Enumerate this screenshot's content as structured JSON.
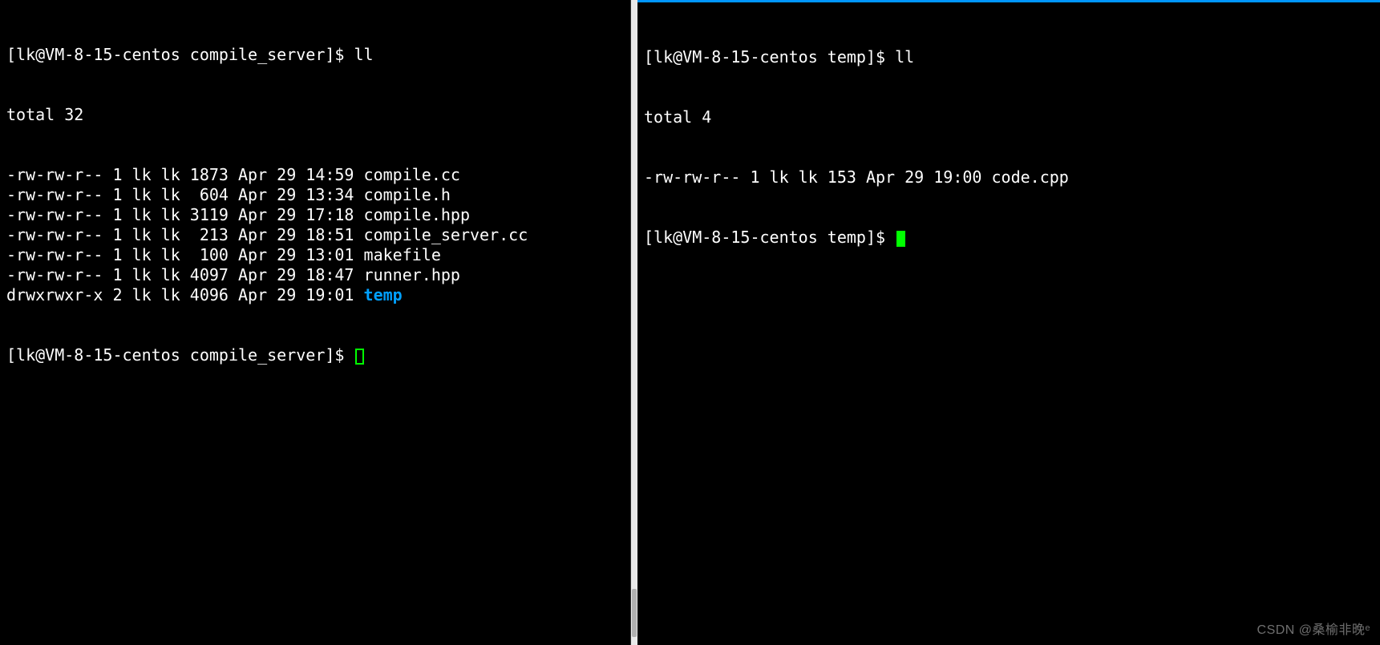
{
  "left": {
    "prompt": "[lk@VM-8-15-centos compile_server]$ ",
    "command": "ll",
    "total": "total 32",
    "entries": [
      {
        "perm": "-rw-rw-r--",
        "links": "1",
        "owner": "lk",
        "group": "lk",
        "size": "1873",
        "date": "Apr 29 14:59",
        "name": "compile.cc",
        "type": "file"
      },
      {
        "perm": "-rw-rw-r--",
        "links": "1",
        "owner": "lk",
        "group": "lk",
        "size": " 604",
        "date": "Apr 29 13:34",
        "name": "compile.h",
        "type": "file"
      },
      {
        "perm": "-rw-rw-r--",
        "links": "1",
        "owner": "lk",
        "group": "lk",
        "size": "3119",
        "date": "Apr 29 17:18",
        "name": "compile.hpp",
        "type": "file"
      },
      {
        "perm": "-rw-rw-r--",
        "links": "1",
        "owner": "lk",
        "group": "lk",
        "size": " 213",
        "date": "Apr 29 18:51",
        "name": "compile_server.cc",
        "type": "file"
      },
      {
        "perm": "-rw-rw-r--",
        "links": "1",
        "owner": "lk",
        "group": "lk",
        "size": " 100",
        "date": "Apr 29 13:01",
        "name": "makefile",
        "type": "file"
      },
      {
        "perm": "-rw-rw-r--",
        "links": "1",
        "owner": "lk",
        "group": "lk",
        "size": "4097",
        "date": "Apr 29 18:47",
        "name": "runner.hpp",
        "type": "file"
      },
      {
        "perm": "drwxrwxr-x",
        "links": "2",
        "owner": "lk",
        "group": "lk",
        "size": "4096",
        "date": "Apr 29 19:01",
        "name": "temp",
        "type": "dir"
      }
    ],
    "prompt2": "[lk@VM-8-15-centos compile_server]$ "
  },
  "right": {
    "prompt": "[lk@VM-8-15-centos temp]$ ",
    "command": "ll",
    "total": "total 4",
    "entries": [
      {
        "perm": "-rw-rw-r--",
        "links": "1",
        "owner": "lk",
        "group": "lk",
        "size": "153",
        "date": "Apr 29 19:00",
        "name": "code.cpp",
        "type": "file"
      }
    ],
    "prompt2": "[lk@VM-8-15-centos temp]$ "
  },
  "watermark": "CSDN @桑榆非晚ᵉ"
}
